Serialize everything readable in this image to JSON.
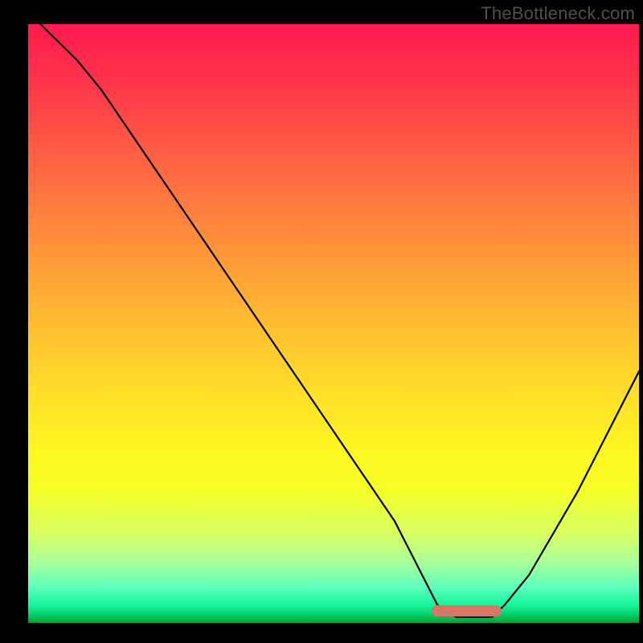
{
  "watermark": "TheBottleneck.com",
  "colors": {
    "frame": "#000000",
    "curve": "#000000",
    "fitted_marker": "#d87768",
    "watermark": "#4f4f4f",
    "gradient_top": "#ff1a4f",
    "gradient_bottom": "#009e35"
  },
  "chart_data": {
    "type": "line",
    "title": "",
    "subtitle": "",
    "xlabel": "",
    "ylabel": "",
    "xlim": [
      0,
      100
    ],
    "ylim": [
      0,
      100
    ],
    "legend": false,
    "grid": false,
    "series": [
      {
        "name": "bottleneck-curve",
        "x": [
          2,
          4,
          8,
          12,
          16,
          20,
          24,
          28,
          32,
          36,
          40,
          44,
          48,
          52,
          56,
          60,
          63,
          65,
          67,
          70,
          74,
          76,
          78,
          82,
          86,
          90,
          94,
          98,
          100
        ],
        "values": [
          100,
          98,
          94,
          89,
          83,
          77,
          71,
          65,
          59,
          53,
          47,
          41,
          35,
          29,
          23,
          17,
          11,
          7,
          3,
          1,
          1,
          1,
          3,
          8,
          15,
          22,
          30,
          38,
          42
        ]
      }
    ],
    "annotations": [
      {
        "name": "fitted-region",
        "shape": "capsule",
        "x_start": 66,
        "x_end": 77.5,
        "y": 2,
        "color": "#d87768"
      }
    ]
  }
}
